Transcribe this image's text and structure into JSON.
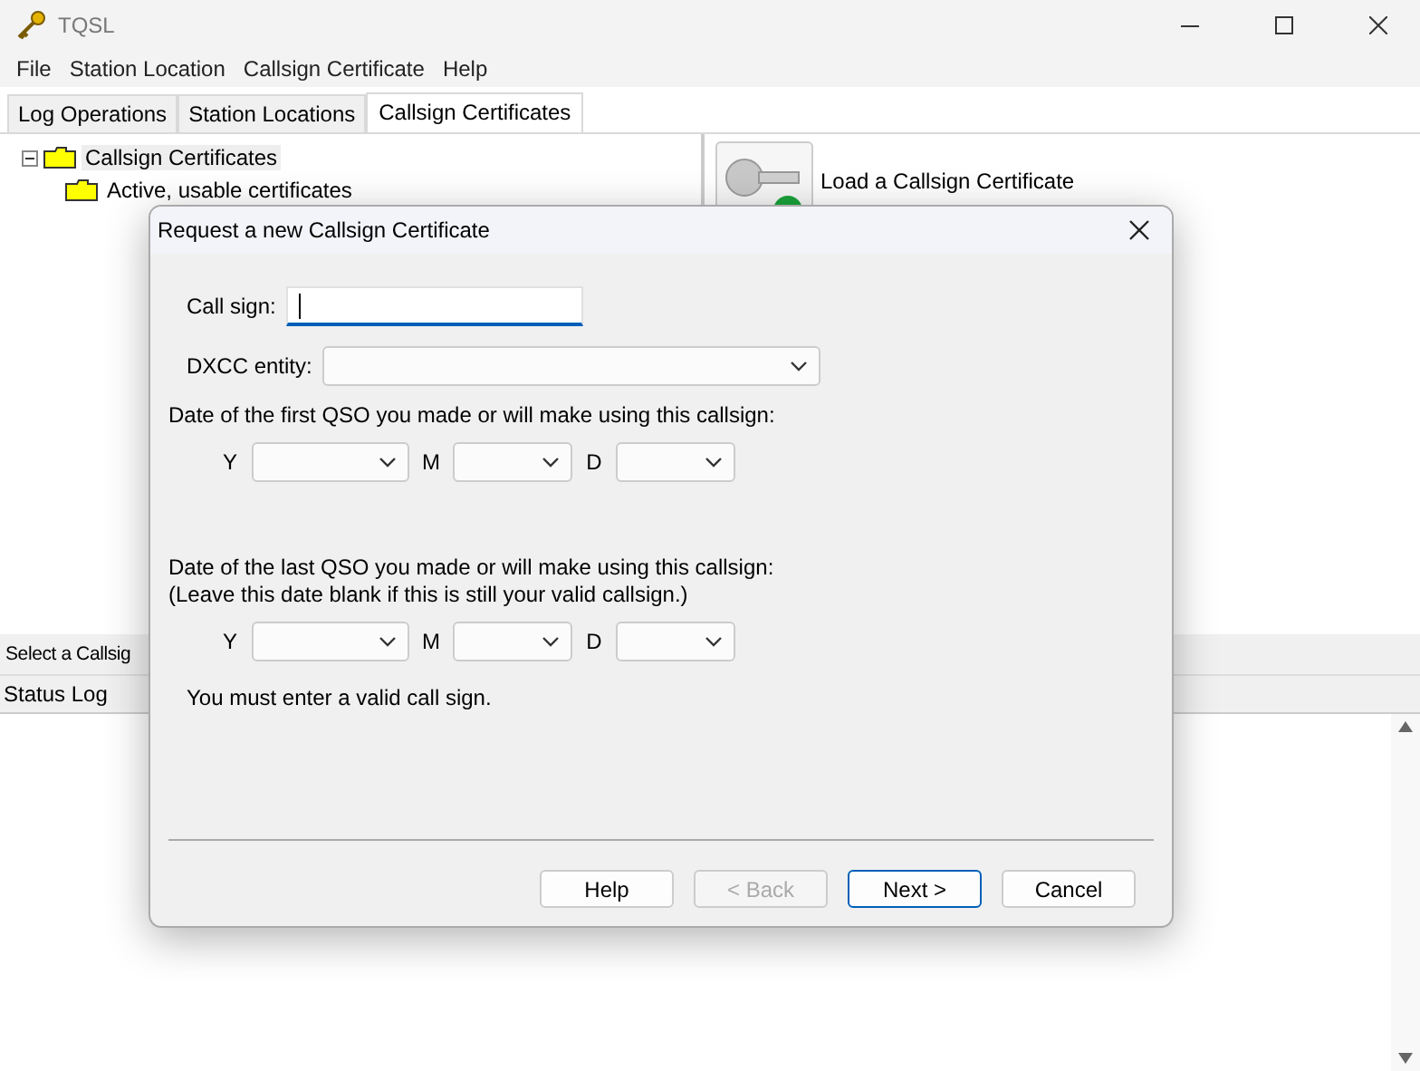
{
  "window": {
    "title": "TQSL"
  },
  "menu": [
    "File",
    "Station Location",
    "Callsign Certificate",
    "Help"
  ],
  "tabs": [
    {
      "label": "Log Operations",
      "selected": false
    },
    {
      "label": "Station Locations",
      "selected": false
    },
    {
      "label": "Callsign Certificates",
      "selected": true
    }
  ],
  "tree": [
    {
      "label": "Callsign Certificates",
      "expanded": true,
      "children": [
        {
          "label": "Active, usable certificates"
        }
      ]
    }
  ],
  "actions": [
    {
      "label": "Load a Callsign Certificate"
    }
  ],
  "selection_hint": "Select a Callsig",
  "status_log": {
    "title": "Status Log"
  },
  "dialog": {
    "title": "Request a new Callsign Certificate",
    "call_sign": {
      "label": "Call sign:"
    },
    "dxcc": {
      "label": "DXCC entity:"
    },
    "first_date": {
      "lines": [
        "Date of the first QSO you made or will make using this callsign:"
      ],
      "parts": [
        "Y",
        "M",
        "D"
      ]
    },
    "last_date": {
      "lines": [
        "Date of the last QSO you made or will make using this callsign:",
        "(Leave this date blank if this is still your valid callsign.)"
      ],
      "parts": [
        "Y",
        "M",
        "D"
      ]
    },
    "message": "You must enter a valid call sign.",
    "buttons": [
      {
        "label": "Help",
        "disabled": false,
        "default": false
      },
      {
        "label": "< Back",
        "disabled": true,
        "default": false
      },
      {
        "label": "Next >",
        "disabled": false,
        "default": true
      },
      {
        "label": "Cancel",
        "disabled": false,
        "default": false
      }
    ]
  }
}
